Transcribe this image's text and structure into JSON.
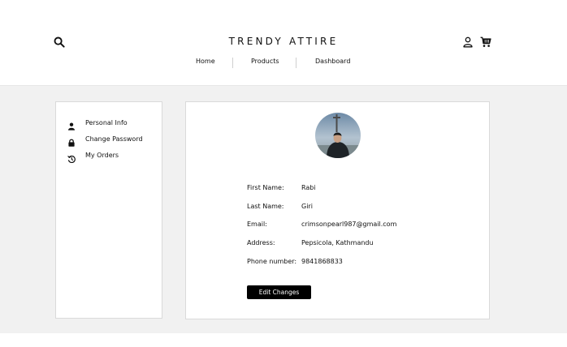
{
  "brand": {
    "title": "TRENDY ATTIRE"
  },
  "nav": {
    "items": [
      {
        "label": "Home"
      },
      {
        "label": "Products"
      },
      {
        "label": "Dashboard"
      }
    ]
  },
  "icons": {
    "search": "search-icon",
    "user": "user-icon",
    "cart": "cart-icon"
  },
  "sidebar": {
    "items": [
      {
        "label": "Personal Info",
        "icon": "person-icon"
      },
      {
        "label": "Change Password",
        "icon": "lock-icon"
      },
      {
        "label": "My Orders",
        "icon": "history-icon"
      }
    ]
  },
  "profile": {
    "fields": [
      {
        "label": "First Name:",
        "value": "Rabi"
      },
      {
        "label": "Last Name:",
        "value": "Giri"
      },
      {
        "label": "Email:",
        "value": "crimsonpearl987@gmail.com"
      },
      {
        "label": "Address:",
        "value": "Pepsicola, Kathmandu"
      },
      {
        "label": "Phone number:",
        "value": "9841868833"
      }
    ],
    "edit_label": "Edit Changes"
  },
  "colors": {
    "accent": "#000000",
    "band": "#f1f1f1",
    "panel_border": "#dadada"
  }
}
